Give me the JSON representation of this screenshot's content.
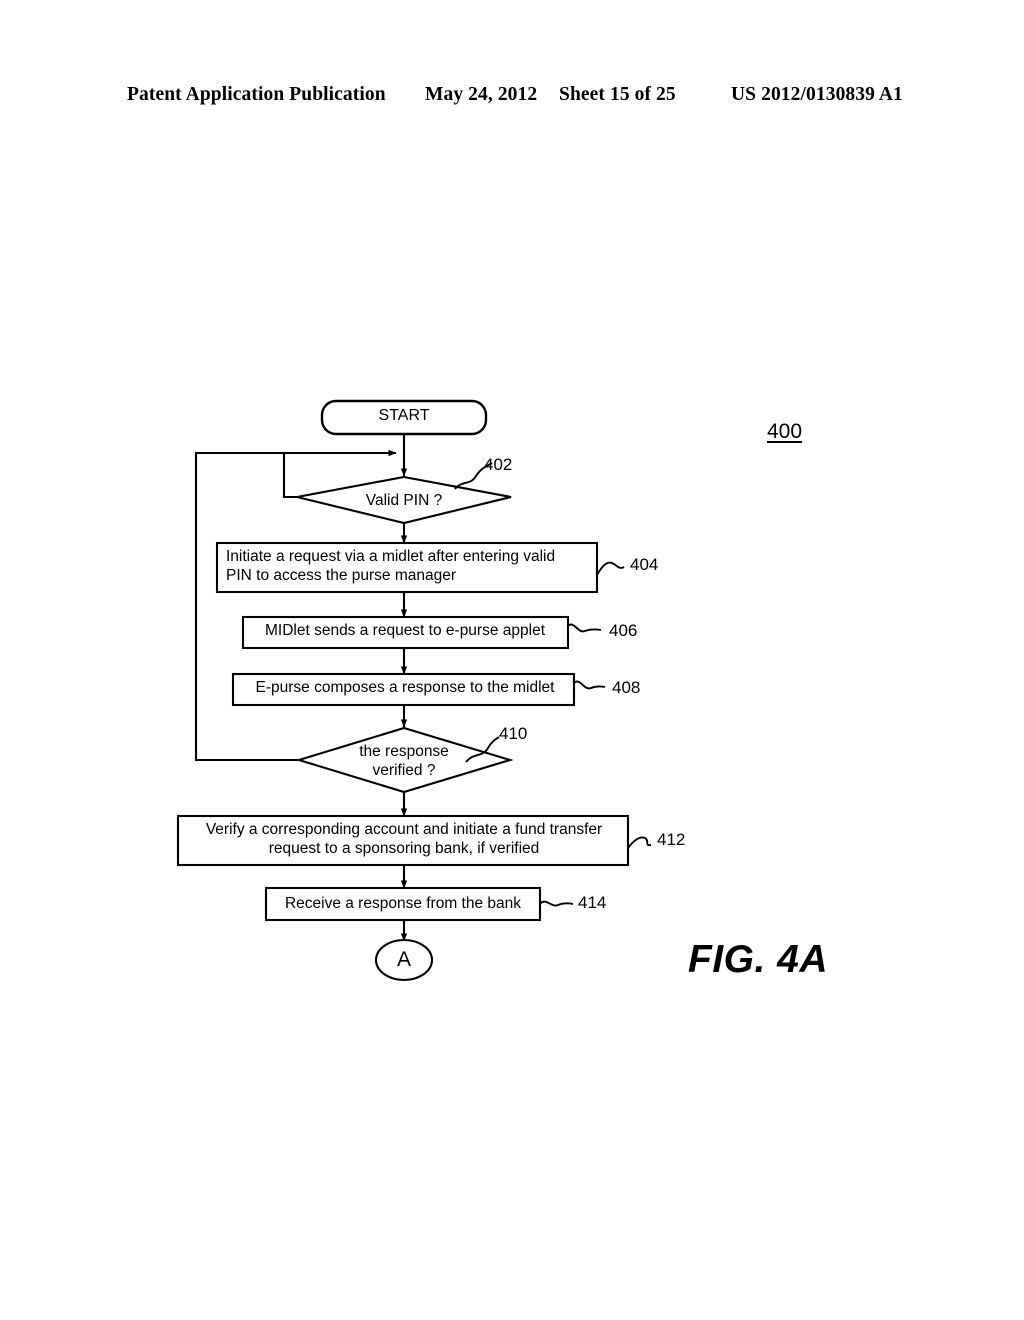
{
  "header": {
    "publication": "Patent Application Publication",
    "date": "May 24, 2012",
    "sheet": "Sheet 15 of 25",
    "patent_number": "US 2012/0130839 A1"
  },
  "figure": {
    "label": "FIG. 4A",
    "reference_numeral": "400",
    "stroke_color": "#000000",
    "fill_color": "#ffffff"
  },
  "flowchart": {
    "nodes": [
      {
        "id": "start",
        "shape": "rounded-rect",
        "text": "START",
        "ref": ""
      },
      {
        "id": "n402",
        "shape": "diamond",
        "text": "Valid PIN ?",
        "ref": "402"
      },
      {
        "id": "n404",
        "shape": "rect",
        "text": "Initiate a request via a midlet after entering valid\nPIN to access the purse manager",
        "ref": "404"
      },
      {
        "id": "n406",
        "shape": "rect",
        "text": "MIDlet sends a request to e-purse applet",
        "ref": "406"
      },
      {
        "id": "n408",
        "shape": "rect",
        "text": "E-purse composes a response to the midlet",
        "ref": "408"
      },
      {
        "id": "n410",
        "shape": "diamond",
        "text": "the response\nverified ?",
        "ref": "410"
      },
      {
        "id": "n412",
        "shape": "rect",
        "text": "Verify a corresponding account and initiate a fund transfer\nrequest to a sponsoring bank, if verified",
        "ref": "412"
      },
      {
        "id": "n414",
        "shape": "rect",
        "text": "Receive a response from the bank",
        "ref": "414"
      },
      {
        "id": "connA",
        "shape": "ellipse",
        "text": "A",
        "ref": ""
      }
    ],
    "ref_numbers": [
      "402",
      "404",
      "406",
      "408",
      "410",
      "412",
      "414"
    ]
  }
}
